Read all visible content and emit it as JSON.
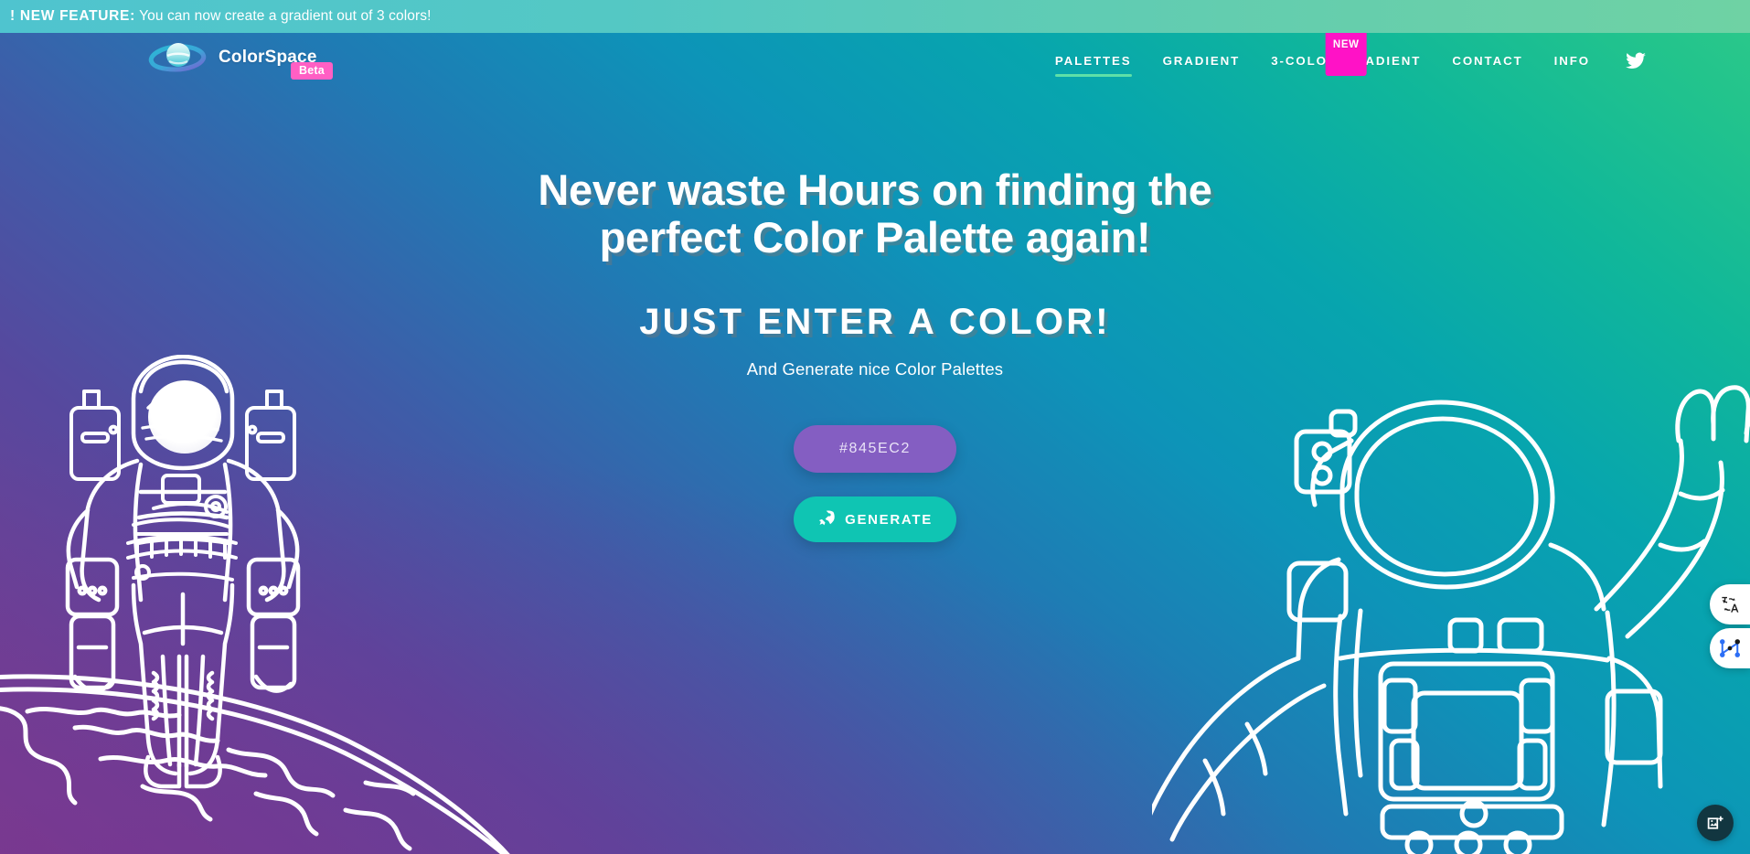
{
  "banner": {
    "strong": "! NEW FEATURE:",
    "text": " You can now create a gradient out of 3 colors!",
    "icon": "exclamation-icon"
  },
  "header": {
    "brand_name": "ColorSpace",
    "logo_icon": "planet-ringed-icon",
    "beta_badge": "Beta",
    "nav": [
      {
        "label": "PALETTES",
        "active": true,
        "badge": null
      },
      {
        "label": "GRADIENT",
        "active": false,
        "badge": null
      },
      {
        "label": "3-COLOR-GRADIENT",
        "active": false,
        "badge": "NEW"
      },
      {
        "label": "CONTACT",
        "active": false,
        "badge": null
      },
      {
        "label": "INFO",
        "active": false,
        "badge": null
      }
    ],
    "twitter_icon": "twitter-bird-icon"
  },
  "hero": {
    "headline_line1": "Never waste Hours on finding the",
    "headline_line2": "perfect Color Palette again!",
    "subheadline": "JUST ENTER A COLOR!",
    "tagline": "And Generate nice Color Palettes",
    "color_value": "#845EC2",
    "color_placeholder": "#845EC2",
    "generate_label": "GENERATE",
    "generate_icon": "rocket-icon"
  },
  "floating": {
    "translate_icon": "translate-icon",
    "nodes_icon": "node-graph-icon",
    "image_icon": "image-add-icon"
  },
  "illustration": {
    "left_icon": "astronaut-standing-on-planet-icon",
    "right_icon": "astronaut-waving-icon",
    "planet_icon": "planet-horizon-icon"
  },
  "colors": {
    "input_bg": "#845EC2",
    "generate_bg": "#0FC5B3",
    "beta_badge_bg": "#FF5FC4",
    "new_badge_bg": "#FF12C6",
    "active_underline": "#5EE0A8",
    "bg_top_left": "#0E90B5",
    "bg_top_right": "#2BC08C",
    "bg_bottom_left": "#653E8C",
    "bg_bottom_right": "#0D93AD"
  }
}
